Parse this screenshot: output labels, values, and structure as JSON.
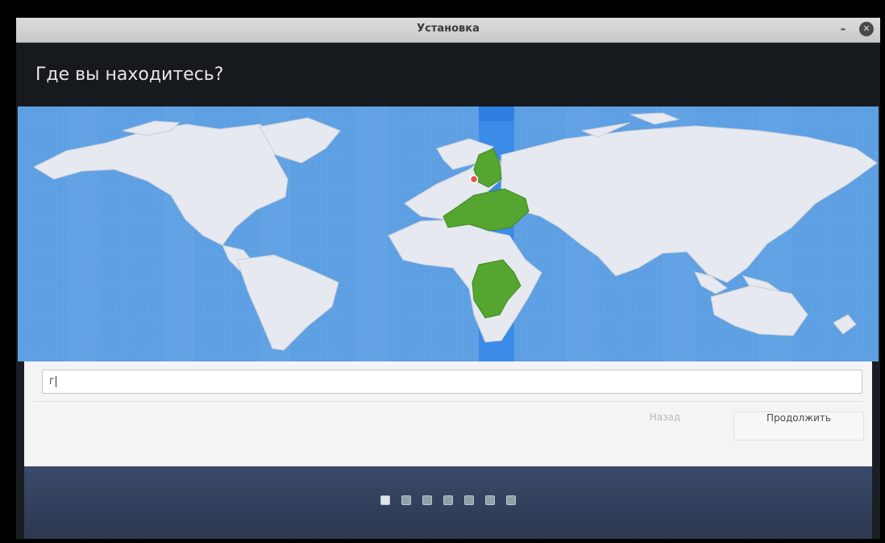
{
  "window": {
    "title": "Установка",
    "minimize_glyph": "-",
    "close_glyph": "✕"
  },
  "page": {
    "heading": "Где вы находитесь?"
  },
  "map": {
    "water_color": "#5d9fe3",
    "land_color": "#e6e9ef",
    "highlight_color": "#55a531",
    "selected_band_color": "#3b8be8",
    "marker_color": "#e0584b"
  },
  "search": {
    "value": "г",
    "placeholder": ""
  },
  "buttons": {
    "back_label": "Назад",
    "continue_label": "Продолжить"
  },
  "progress": {
    "steps": 7,
    "current_step": 1
  }
}
